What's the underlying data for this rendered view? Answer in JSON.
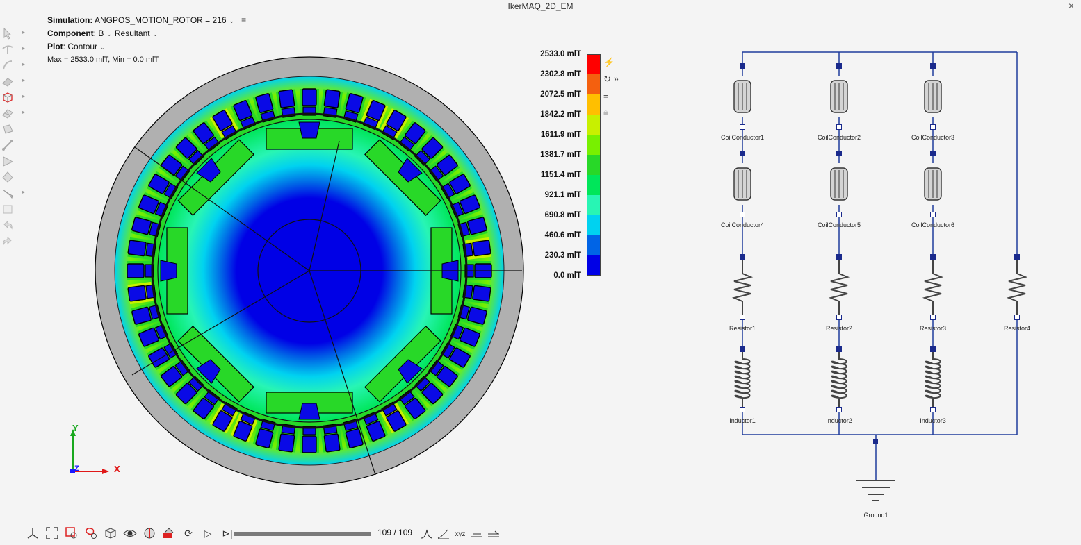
{
  "window": {
    "title": "IkerMAQ_2D_EM",
    "close": "×"
  },
  "info": {
    "simulation_label": "Simulation:",
    "simulation_value": "ANGPOS_MOTION_ROTOR = 216",
    "component_label": "Component",
    "component_value": "B",
    "component_sub": "Resultant",
    "plot_label": "Plot",
    "plot_value": "Contour",
    "maxmin": "Max = 2533.0 mlT, Min = 0.0 mlT"
  },
  "legend": {
    "labels": [
      "2533.0 mlT",
      "2302.8 mlT",
      "2072.5 mlT",
      "1842.2 mlT",
      "1611.9 mlT",
      "1381.7 mlT",
      "1151.4 mlT",
      "921.1 mlT",
      "690.8 mlT",
      "460.6 mlT",
      "230.3 mlT",
      "0.0 mlT"
    ],
    "colors": [
      "#ff0000",
      "#f4600f",
      "#ffbf00",
      "#c8f000",
      "#78f000",
      "#28d828",
      "#00e65a",
      "#28f5b4",
      "#00d2f0",
      "#0064e6",
      "#0000e6"
    ]
  },
  "triad": {
    "y": "Y",
    "x": "X",
    "z": "Z"
  },
  "circuit": {
    "coils": [
      "CoilConductor1",
      "CoilConductor2",
      "CoilConductor3",
      "CoilConductor4",
      "CoilConductor5",
      "CoilConductor6"
    ],
    "resistors": [
      "Resistor1",
      "Resistor2",
      "Resistor3",
      "Resistor4"
    ],
    "inductors": [
      "Inductor1",
      "Inductor2",
      "Inductor3"
    ],
    "ground": "Ground1"
  },
  "playback": {
    "frame": "109 / 109"
  },
  "icons": [
    "select-arrow-icon",
    "curve-icon",
    "arc-icon",
    "surface-icon",
    "solid-cube-icon",
    "mesh-icon",
    "shell-icon",
    "edge-icon",
    "triangle-icon",
    "solid-icon",
    "probe-icon",
    "box-icon",
    "undo-icon",
    "redo-icon"
  ]
}
